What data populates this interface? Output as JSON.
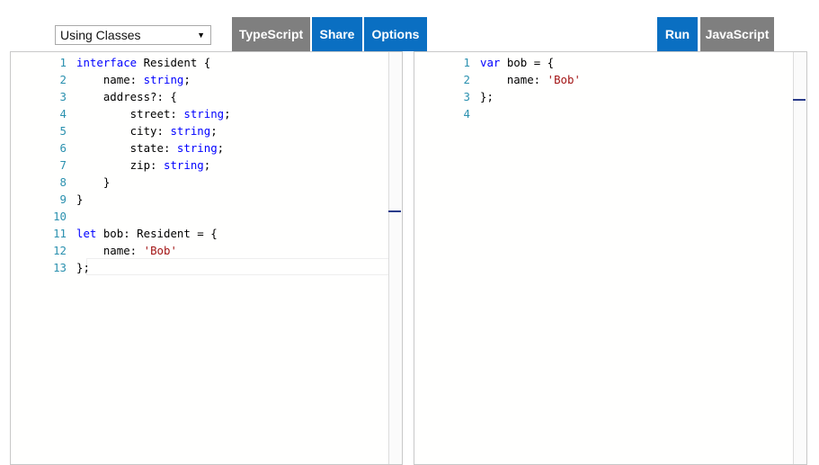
{
  "toolbar": {
    "example_select": "Using Classes",
    "typescript_label": "TypeScript",
    "share_label": "Share",
    "options_label": "Options",
    "run_label": "Run",
    "javascript_label": "JavaScript"
  },
  "editor_left": {
    "lines": [
      {
        "n": "1",
        "t": [
          [
            "kw",
            "interface"
          ],
          [
            "p",
            " Resident {"
          ]
        ]
      },
      {
        "n": "2",
        "t": [
          [
            "p",
            "    name: "
          ],
          [
            "ty",
            "string"
          ],
          [
            "p",
            ";"
          ]
        ]
      },
      {
        "n": "3",
        "t": [
          [
            "p",
            "    address?: {"
          ]
        ]
      },
      {
        "n": "4",
        "t": [
          [
            "p",
            "        street: "
          ],
          [
            "ty",
            "string"
          ],
          [
            "p",
            ";"
          ]
        ]
      },
      {
        "n": "5",
        "t": [
          [
            "p",
            "        city: "
          ],
          [
            "ty",
            "string"
          ],
          [
            "p",
            ";"
          ]
        ]
      },
      {
        "n": "6",
        "t": [
          [
            "p",
            "        state: "
          ],
          [
            "ty",
            "string"
          ],
          [
            "p",
            ";"
          ]
        ]
      },
      {
        "n": "7",
        "t": [
          [
            "p",
            "        zip: "
          ],
          [
            "ty",
            "string"
          ],
          [
            "p",
            ";"
          ]
        ]
      },
      {
        "n": "8",
        "t": [
          [
            "p",
            "    }"
          ]
        ]
      },
      {
        "n": "9",
        "t": [
          [
            "p",
            "}"
          ]
        ]
      },
      {
        "n": "10",
        "t": []
      },
      {
        "n": "11",
        "t": [
          [
            "kw",
            "let"
          ],
          [
            "p",
            " bob: Resident = {"
          ]
        ]
      },
      {
        "n": "12",
        "t": [
          [
            "p",
            "    name: "
          ],
          [
            "str",
            "'Bob'"
          ]
        ]
      },
      {
        "n": "13",
        "t": [
          [
            "p",
            "};"
          ]
        ]
      }
    ]
  },
  "editor_right": {
    "lines": [
      {
        "n": "1",
        "t": [
          [
            "kw",
            "var"
          ],
          [
            "p",
            " bob = {"
          ]
        ]
      },
      {
        "n": "2",
        "t": [
          [
            "p",
            "    name: "
          ],
          [
            "str",
            "'Bob'"
          ]
        ]
      },
      {
        "n": "3",
        "t": [
          [
            "p",
            "};"
          ]
        ]
      },
      {
        "n": "4",
        "t": []
      }
    ]
  },
  "colors": {
    "button_blue": "#0a6fc2",
    "button_gray": "#7f7f7f",
    "keyword": "#0000ff",
    "string": "#a31515",
    "line_number": "#2b91af"
  }
}
